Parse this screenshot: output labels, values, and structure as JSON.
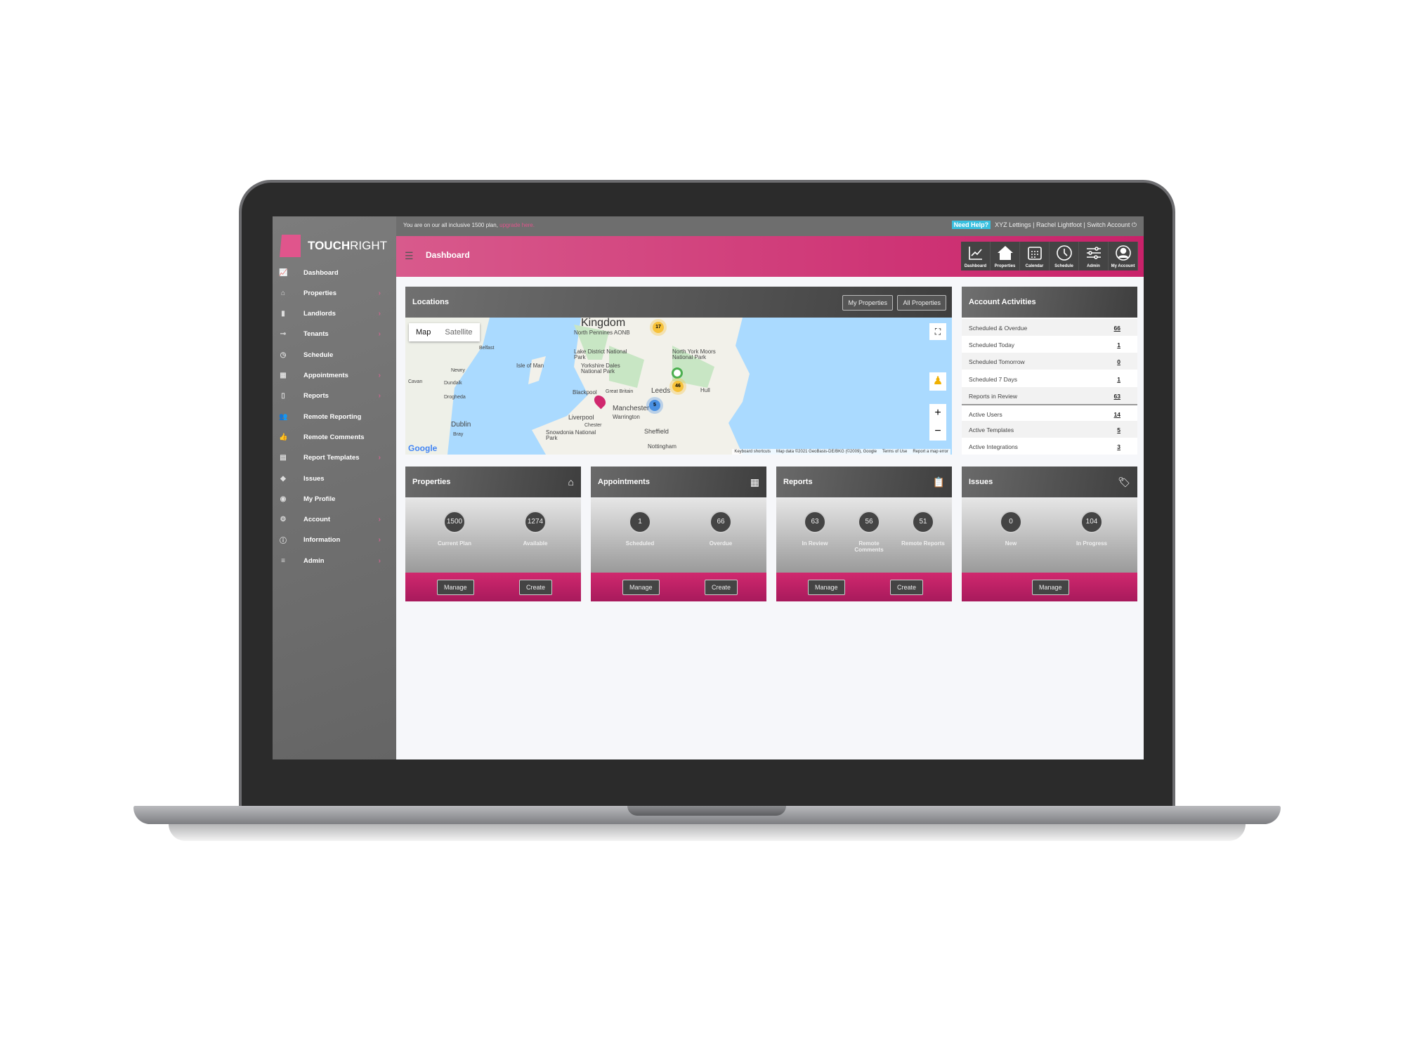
{
  "topbar": {
    "plan_text": "You are on our all inclusive 1500 plan,",
    "upgrade_link": "upgrade here.",
    "need_help": "Need Help?",
    "account_info": "XYZ Lettings | Rachel Lightfoot | Switch Account"
  },
  "brand": {
    "name_bold": "TOUCH",
    "name_light": "RIGHT",
    "accent": "#d0286e"
  },
  "header": {
    "title": "Dashboard"
  },
  "topnav": [
    {
      "label": "Dashboard",
      "icon": "chart-icon"
    },
    {
      "label": "Properties",
      "icon": "house-icon"
    },
    {
      "label": "Calendar",
      "icon": "calendar-icon"
    },
    {
      "label": "Schedule",
      "icon": "clock-icon"
    },
    {
      "label": "Admin",
      "icon": "sliders-icon"
    },
    {
      "label": "My Account",
      "icon": "user-icon"
    }
  ],
  "sidebar": {
    "items": [
      {
        "label": "Dashboard",
        "icon": "chart-icon",
        "glyph": "📈",
        "chevron": false
      },
      {
        "label": "Properties",
        "icon": "house-icon",
        "glyph": "⌂",
        "chevron": true
      },
      {
        "label": "Landlords",
        "icon": "door-icon",
        "glyph": "▮",
        "chevron": true
      },
      {
        "label": "Tenants",
        "icon": "key-icon",
        "glyph": "⊸",
        "chevron": true
      },
      {
        "label": "Schedule",
        "icon": "clock-icon",
        "glyph": "◷",
        "chevron": false
      },
      {
        "label": "Appointments",
        "icon": "calendar-icon",
        "glyph": "▦",
        "chevron": true
      },
      {
        "label": "Reports",
        "icon": "clipboard-icon",
        "glyph": "▯",
        "chevron": true
      },
      {
        "label": "Remote Reporting",
        "icon": "users-icon",
        "glyph": "👥",
        "chevron": false
      },
      {
        "label": "Remote Comments",
        "icon": "thumbs-icon",
        "glyph": "👍",
        "chevron": false
      },
      {
        "label": "Report Templates",
        "icon": "calculator-icon",
        "glyph": "▤",
        "chevron": true
      },
      {
        "label": "Issues",
        "icon": "tag-icon",
        "glyph": "◆",
        "chevron": false
      },
      {
        "label": "My Profile",
        "icon": "user-circle-icon",
        "glyph": "◉",
        "chevron": false
      },
      {
        "label": "Account",
        "icon": "gear-icon",
        "glyph": "⚙",
        "chevron": true
      },
      {
        "label": "Information",
        "icon": "info-icon",
        "glyph": "ⓘ",
        "chevron": true
      },
      {
        "label": "Admin",
        "icon": "sliders-icon",
        "glyph": "≡",
        "chevron": true
      }
    ]
  },
  "locations": {
    "title": "Locations",
    "my_properties": "My Properties",
    "all_properties": "All Properties",
    "map": {
      "map_tab": "Map",
      "satellite_tab": "Satellite",
      "labels": [
        "Kingdom",
        "North Pennines AONB",
        "Lake District National Park",
        "Isle of Man",
        "Yorkshire Dales National Park",
        "North York Moors National Park",
        "Leeds",
        "Hull",
        "Blackpool",
        "Great Britain",
        "Manchester",
        "Liverpool",
        "Warrington",
        "Sheffield",
        "Chester",
        "Snowdonia National Park",
        "Nottingham",
        "Dublin",
        "Dundalk",
        "Drogheda",
        "Newry",
        "Belfast",
        "Bray",
        "Cavan"
      ],
      "clusters": [
        {
          "count": "17",
          "color": "#f7c23a"
        },
        {
          "count": "46",
          "color": "#f7c23a"
        },
        {
          "count": "5",
          "color": "#4a90e2"
        }
      ],
      "attribution": [
        "Keyboard shortcuts",
        "Map data ©2021 GeoBasis-DE/BKG (©2009), Google",
        "Terms of Use",
        "Report a map error"
      ],
      "google": "Google"
    }
  },
  "activities": {
    "title": "Account Activities",
    "rows": [
      {
        "label": "Scheduled & Overdue",
        "value": "66"
      },
      {
        "label": "Scheduled Today",
        "value": "1"
      },
      {
        "label": "Scheduled Tomorrow",
        "value": "0"
      },
      {
        "label": "Scheduled 7 Days",
        "value": "1"
      },
      {
        "label": "Reports in Review",
        "value": "63"
      },
      {
        "label": "Active Users",
        "value": "14"
      },
      {
        "label": "Active Templates",
        "value": "5"
      },
      {
        "label": "Active Integrations",
        "value": "3"
      }
    ]
  },
  "cards": [
    {
      "title": "Properties",
      "icon": "house-icon",
      "stats": [
        {
          "value": "1500",
          "label": "Current Plan"
        },
        {
          "value": "1274",
          "label": "Available"
        }
      ],
      "buttons": [
        "Manage",
        "Create"
      ]
    },
    {
      "title": "Appointments",
      "icon": "calendar-icon",
      "stats": [
        {
          "value": "1",
          "label": "Scheduled"
        },
        {
          "value": "66",
          "label": "Overdue"
        }
      ],
      "buttons": [
        "Manage",
        "Create"
      ]
    },
    {
      "title": "Reports",
      "icon": "clipboard-icon",
      "stats": [
        {
          "value": "63",
          "label": "In Review"
        },
        {
          "value": "56",
          "label": "Remote Comments"
        },
        {
          "value": "51",
          "label": "Remote Reports"
        }
      ],
      "buttons": [
        "Manage",
        "Create"
      ]
    },
    {
      "title": "Issues",
      "icon": "tag-icon",
      "stats": [
        {
          "value": "0",
          "label": "New"
        },
        {
          "value": "104",
          "label": "In Progress"
        }
      ],
      "buttons": [
        "Manage"
      ]
    }
  ]
}
